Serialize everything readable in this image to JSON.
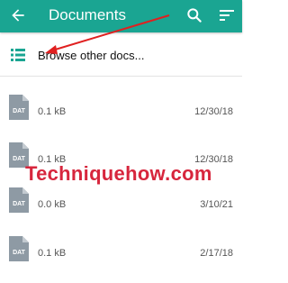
{
  "appbar": {
    "title": "Documents",
    "background": "#1aa592"
  },
  "browse": {
    "label": "Browse other docs..."
  },
  "files": [
    {
      "name": "",
      "size": "0.1 kB",
      "date": "12/30/18",
      "icon_label": "DAT"
    },
    {
      "name": "",
      "size": "0.1 kB",
      "date": "12/30/18",
      "icon_label": "DAT"
    },
    {
      "name": "",
      "size": "0.0 kB",
      "date": "3/10/21",
      "icon_label": "DAT"
    },
    {
      "name": "",
      "size": "0.1 kB",
      "date": "2/17/18",
      "icon_label": "DAT"
    }
  ],
  "watermark": {
    "text": "Techniquehow.com",
    "color": "#d7263d"
  },
  "annotation": {
    "arrow_color": "#e02020"
  }
}
